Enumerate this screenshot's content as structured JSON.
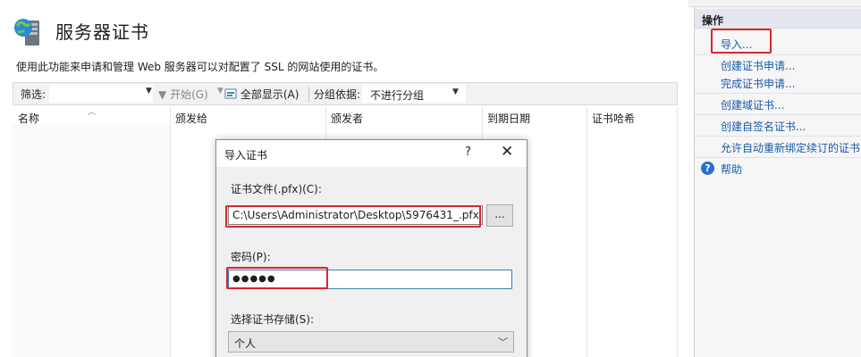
{
  "page": {
    "title": "服务器证书",
    "description": "使用此功能来申请和管理 Web 服务器可以对配置了 SSL 的网站使用的证书。"
  },
  "toolbar": {
    "filter_label": "筛选:",
    "start_label": "开始(G)",
    "show_all_label": "全部显示(A)",
    "group_by_label": "分组依据:",
    "group_by_value": "不进行分组"
  },
  "table": {
    "columns": [
      "名称",
      "颁发给",
      "颁发者",
      "到期日期",
      "证书哈希"
    ]
  },
  "dialog": {
    "title": "导入证书",
    "help": "?",
    "close": "✕",
    "file_label": "证书文件(.pfx)(C):",
    "file_value": "C:\\Users\\Administrator\\Desktop\\5976431_.pfx",
    "browse_label": "...",
    "password_label": "密码(P):",
    "password_value": "●●●●●",
    "store_label": "选择证书存储(S):",
    "store_value": "个人"
  },
  "actions": {
    "title": "操作",
    "items": [
      "导入...",
      "创建证书申请...",
      "完成证书申请...",
      "创建域证书...",
      "创建自签名证书...",
      "允许自动重新绑定续订的证书"
    ],
    "help_label": "帮助"
  },
  "colors": {
    "link": "#1a5aa8",
    "highlight_box": "#d8262e",
    "focus_border": "#3c7fb1"
  }
}
